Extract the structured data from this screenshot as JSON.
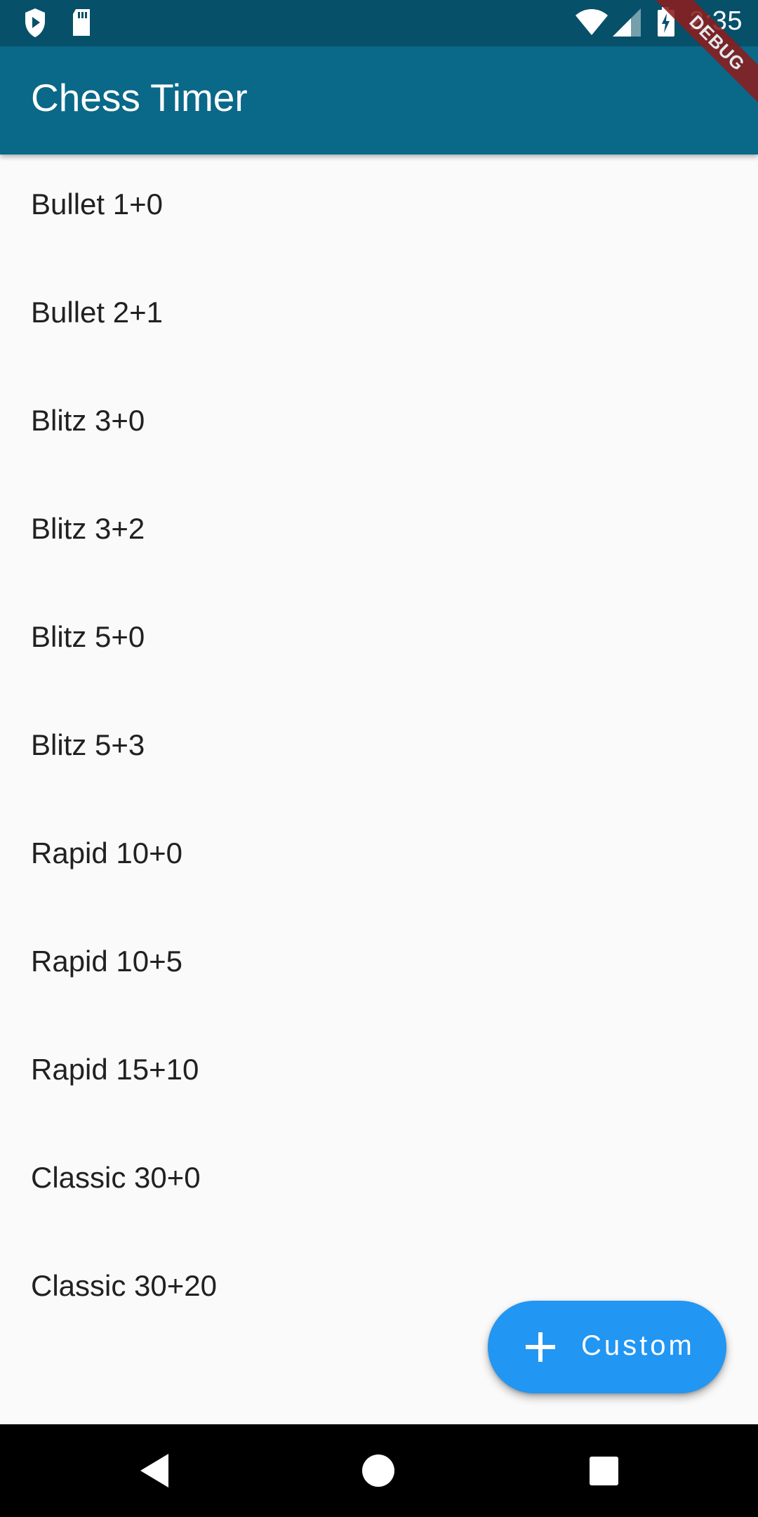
{
  "status_bar": {
    "time": "2:35",
    "icons": [
      "shield-play-icon",
      "sd-card-icon",
      "wifi-icon",
      "cell-signal-icon",
      "battery-charging-icon"
    ],
    "background": "#075069"
  },
  "app_bar": {
    "title": "Chess Timer",
    "background": "#0a6889"
  },
  "debug_banner": {
    "label": "DEBUG",
    "color": "#8b1d1d"
  },
  "presets": [
    {
      "label": "Bullet 1+0"
    },
    {
      "label": "Bullet 2+1"
    },
    {
      "label": "Blitz 3+0"
    },
    {
      "label": "Blitz 3+2"
    },
    {
      "label": "Blitz 5+0"
    },
    {
      "label": "Blitz 5+3"
    },
    {
      "label": "Rapid 10+0"
    },
    {
      "label": "Rapid 10+5"
    },
    {
      "label": "Rapid 15+10"
    },
    {
      "label": "Classic 30+0"
    },
    {
      "label": "Classic 30+20"
    }
  ],
  "fab": {
    "icon": "plus-icon",
    "label": "Custom",
    "color": "#2196f3"
  },
  "nav_bar": {
    "buttons": [
      "back-icon",
      "home-icon",
      "recents-icon"
    ]
  }
}
